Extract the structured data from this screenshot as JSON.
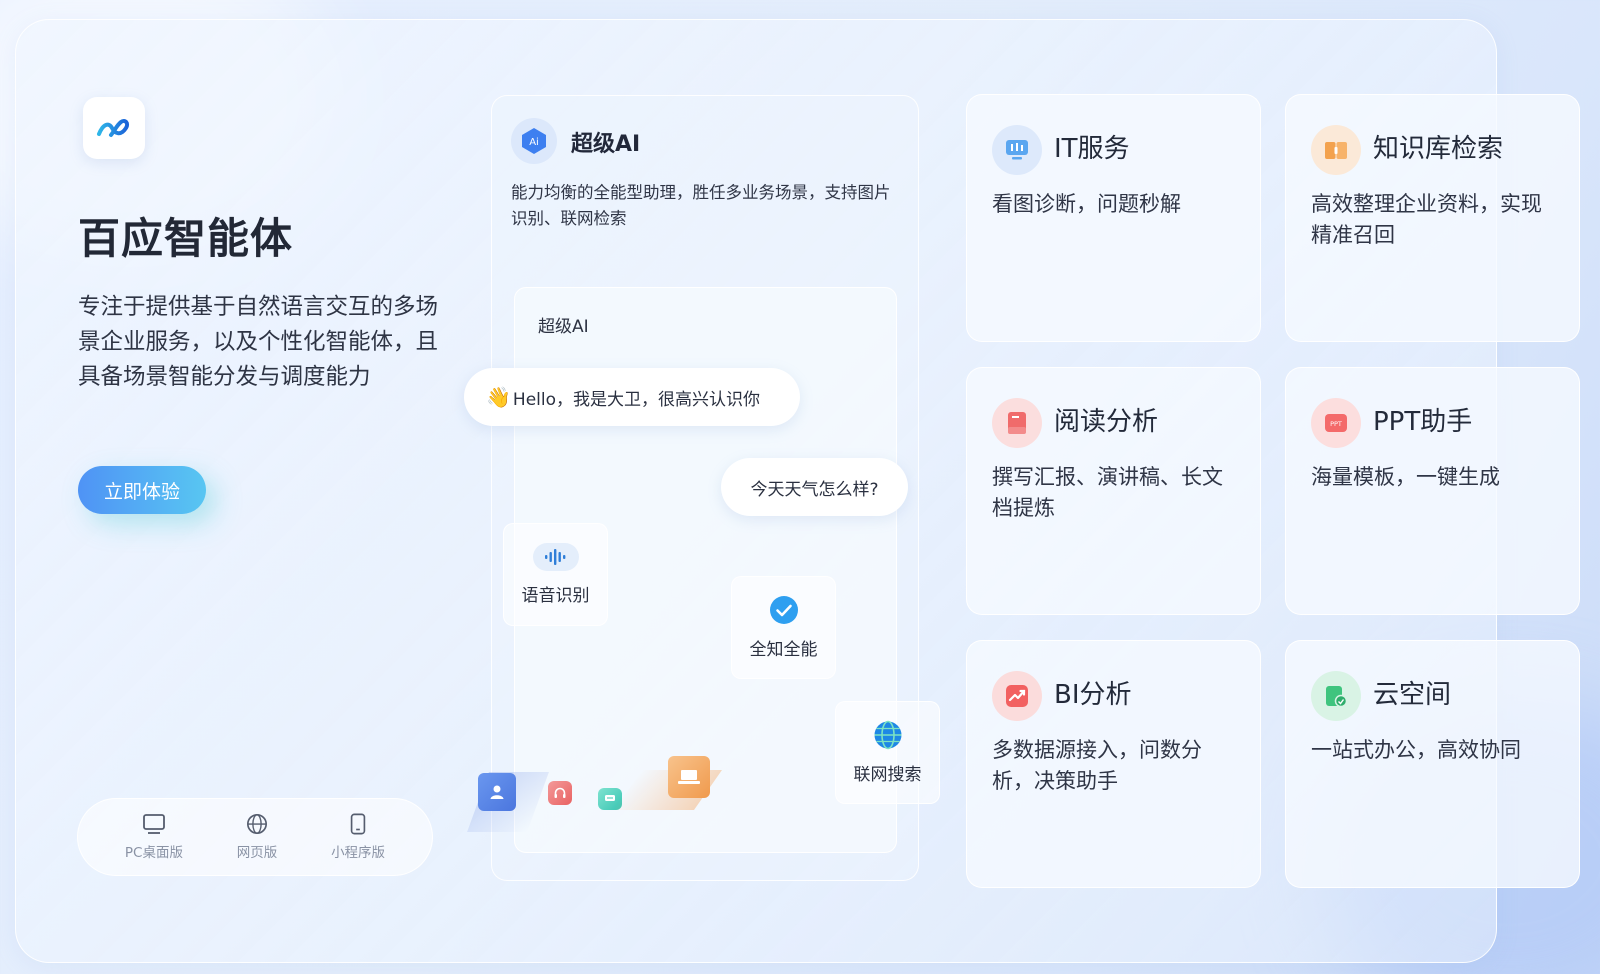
{
  "brand": {
    "title": "百应智能体",
    "description": "专注于提供基于自然语言交互的多场景企业服务，以及个性化智能体，且具备场景智能分发与调度能力",
    "cta_label": "立即体验"
  },
  "platforms": [
    {
      "label": "PC桌面版",
      "icon": "monitor-icon"
    },
    {
      "label": "网页版",
      "icon": "globe-icon"
    },
    {
      "label": "小程序版",
      "icon": "phone-icon"
    }
  ],
  "ai_card": {
    "title": "超级AI",
    "icon_text": "Ai",
    "description": "能力均衡的全能型助理，胜任多业务场景，支持图片识别、联网检索",
    "chat": {
      "label": "超级AI",
      "greeting": "Hello，我是大卫，很高兴认识你",
      "user_message": "今天天气怎么样?"
    },
    "features": [
      {
        "label": "语音识别",
        "icon": "voice-wave-icon"
      },
      {
        "label": "全知全能",
        "icon": "check-circle-icon"
      },
      {
        "label": "联网搜索",
        "icon": "globe-icon"
      }
    ]
  },
  "services": [
    {
      "title": "IT服务",
      "description": "看图诊断，问题秒解",
      "icon": "monitor-icon",
      "color": "#5aa6f0"
    },
    {
      "title": "知识库检索",
      "description": "高效整理企业资料，实现精准召回",
      "icon": "book-icon",
      "color": "#f3a24e"
    },
    {
      "title": "阅读分析",
      "description": "撰写汇报、演讲稿、长文档提炼",
      "icon": "document-icon",
      "color": "#f06b6b"
    },
    {
      "title": "PPT助手",
      "description": "海量模板，一键生成",
      "icon": "ppt-icon",
      "color": "#f46a6a"
    },
    {
      "title": "BI分析",
      "description": "多数据源接入，问数分析，决策助手",
      "icon": "chart-icon",
      "color": "#f26060"
    },
    {
      "title": "云空间",
      "description": "一站式办公，高效协同",
      "icon": "cloud-folder-icon",
      "color": "#3fc47e"
    }
  ],
  "colors": {
    "accent_start": "#4f93f5",
    "accent_end": "#58c6f2"
  }
}
